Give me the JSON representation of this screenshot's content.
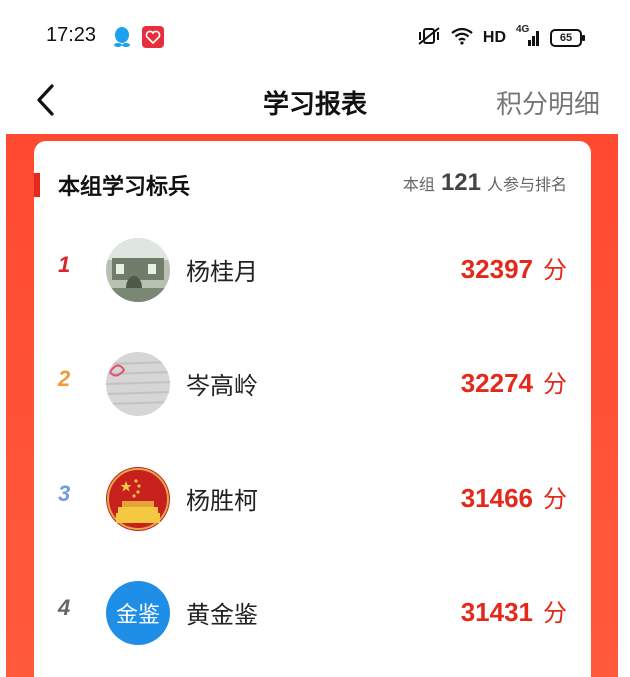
{
  "status_bar": {
    "time": "17:23",
    "network_label": "HD",
    "network_gen": "4G",
    "battery": "65"
  },
  "nav": {
    "title": "学习报表",
    "right_label": "积分明细"
  },
  "card": {
    "title": "本组学习标兵",
    "participants_prefix": "本组",
    "participants_count": "121",
    "participants_suffix": "人参与排名"
  },
  "ranking": [
    {
      "rank": "1",
      "name": "杨桂月",
      "score": "32397",
      "unit": "分",
      "rank_color": "#d9262a"
    },
    {
      "rank": "2",
      "name": "岑高岭",
      "score": "32274",
      "unit": "分",
      "rank_color": "#f29a3a"
    },
    {
      "rank": "3",
      "name": "杨胜柯",
      "score": "31466",
      "unit": "分",
      "rank_color": "#6f9fd8"
    },
    {
      "rank": "4",
      "name": "黄金鉴",
      "score": "31431",
      "unit": "分",
      "rank_color": "#666666",
      "avatar_text": "金鉴"
    }
  ],
  "colors": {
    "accent": "#e4291b",
    "header_bg": "#ff4a30"
  }
}
